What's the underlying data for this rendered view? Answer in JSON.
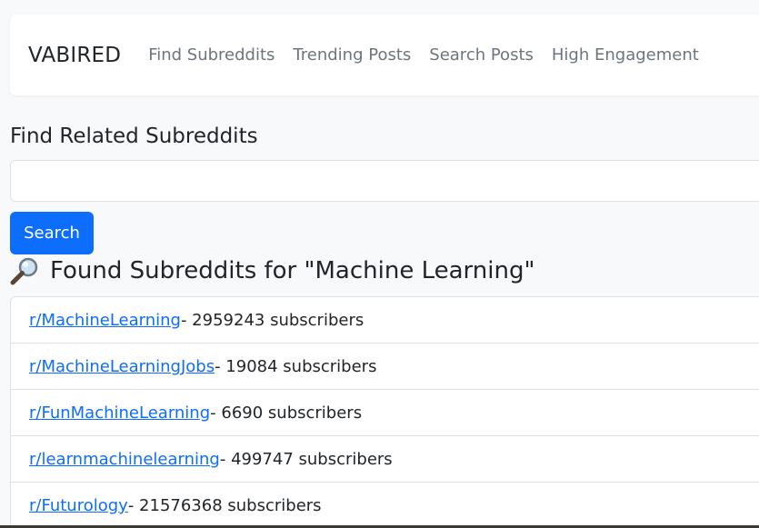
{
  "navbar": {
    "brand": "VABIRED",
    "links": [
      {
        "label": "Find Subreddits"
      },
      {
        "label": "Trending Posts"
      },
      {
        "label": "Search Posts"
      },
      {
        "label": "High Engagement"
      }
    ]
  },
  "search": {
    "title": "Find Related Subreddits",
    "value": "",
    "placeholder": "",
    "button_label": "Search"
  },
  "results": {
    "icon": "magnifying-glass-icon",
    "heading": "Found Subreddits for \"Machine Learning\"",
    "items": [
      {
        "name": "r/MachineLearning",
        "suffix": " - 2959243 subscribers"
      },
      {
        "name": "r/MachineLearningJobs",
        "suffix": " - 19084 subscribers"
      },
      {
        "name": "r/FunMachineLearning",
        "suffix": " - 6690 subscribers"
      },
      {
        "name": "r/learnmachinelearning",
        "suffix": " - 499747 subscribers"
      },
      {
        "name": "r/Futurology",
        "suffix": " - 21576368 subscribers"
      }
    ]
  },
  "colors": {
    "primary": "#0d6efd",
    "nav_text": "#6c757d",
    "background": "#f8f9fa"
  }
}
